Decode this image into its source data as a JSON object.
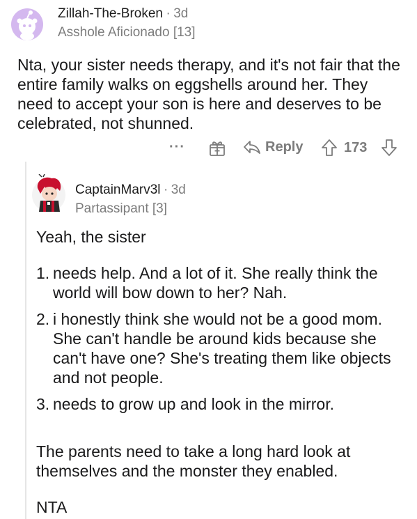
{
  "comment": {
    "username": "Zillah-The-Broken",
    "separator": "·",
    "time": "3d",
    "flair": "Asshole Aficionado [13]",
    "body": "Nta, your sister needs therapy, and it's not fair that the entire family walks on eggshells around her. They need to accept your son is here and deserves to be celebrated, not shunned.",
    "actions": {
      "more": "···",
      "reply_label": "Reply",
      "score": "173"
    }
  },
  "reply": {
    "username": "CaptainMarv3l",
    "separator": "·",
    "time": "3d",
    "flair": "Partassipant [3]",
    "intro": "Yeah, the sister",
    "items": [
      {
        "num": "1.",
        "text": "needs help. And a lot of it. She really think the world will bow down to her? Nah."
      },
      {
        "num": "2.",
        "text": "i honestly think she would not be a good mom. She can't handle be around kids because she can't have one? She's treating them like objects and not people."
      },
      {
        "num": "3.",
        "text": "needs to grow up and look in the mirror."
      }
    ],
    "closing": "The parents need to take a long hard look at themselves and the monster they enabled.",
    "verdict": "NTA"
  },
  "icons": {
    "avatar1": "snoo-avatar",
    "avatar2": "red-hair-avatar",
    "award": "award-icon",
    "reply": "reply-arrow-icon",
    "upvote": "upvote-icon",
    "downvote": "downvote-icon"
  },
  "colors": {
    "avatar1_bg": "#d4b8ef",
    "meta_gray": "#7c7c7c"
  }
}
